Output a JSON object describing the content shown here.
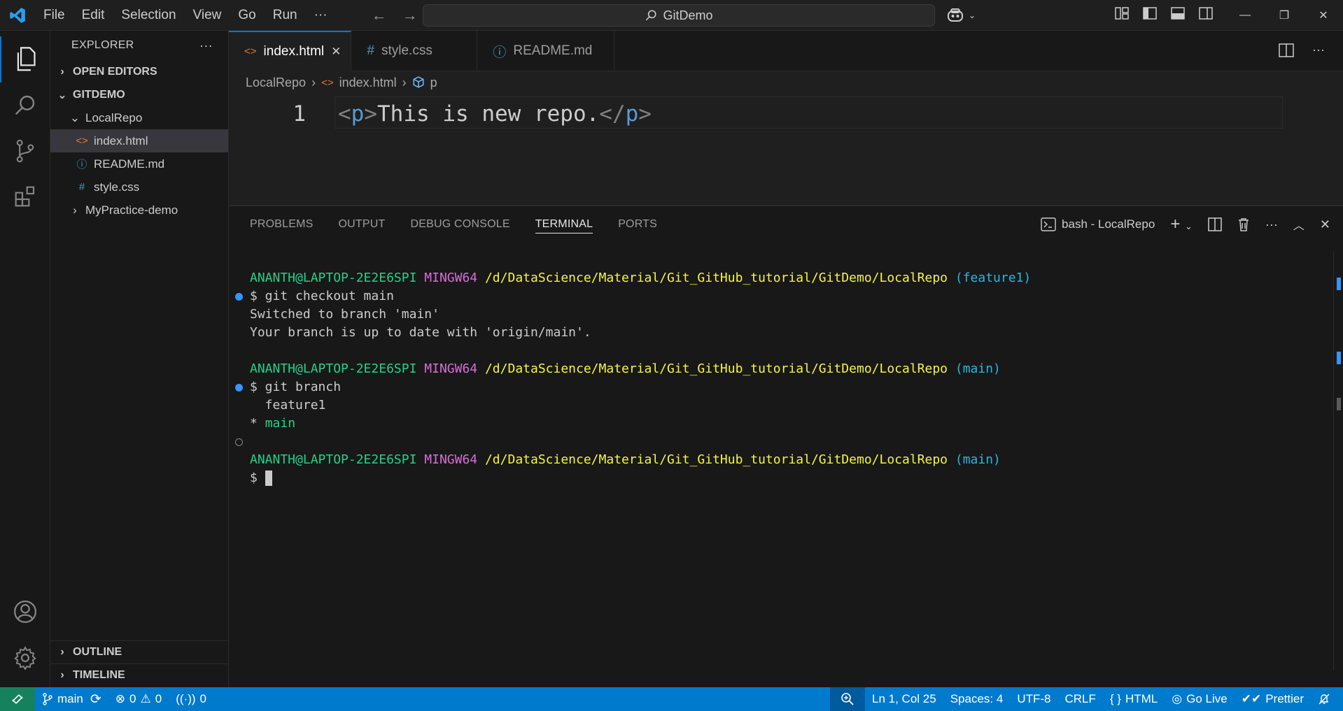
{
  "titlebar": {
    "menu": [
      "File",
      "Edit",
      "Selection",
      "View",
      "Go",
      "Run",
      "···"
    ],
    "search_text": "GitDemo"
  },
  "sidebar": {
    "title": "EXPLORER",
    "more": "···",
    "open_editors": "OPEN EDITORS",
    "workspace": "GITDEMO",
    "folder": "LocalRepo",
    "files": [
      "index.html",
      "README.md",
      "style.css"
    ],
    "other_folder": "MyPractice-demo",
    "outline": "OUTLINE",
    "timeline": "TIMELINE"
  },
  "tabs": [
    {
      "label": "index.html",
      "icon": "<>",
      "close": "✕"
    },
    {
      "label": "style.css",
      "icon": "#"
    },
    {
      "label": "README.md",
      "icon": "ⓘ"
    }
  ],
  "breadcrumb": {
    "folder": "LocalRepo",
    "file": "index.html",
    "symbol": "p"
  },
  "editor": {
    "line_number": "1",
    "open_lt": "<",
    "open_tag": "p",
    "open_gt": ">",
    "text": "This is new repo.",
    "close_lt": "</",
    "close_tag": "p",
    "close_gt": ">"
  },
  "panel": {
    "tabs": [
      "PROBLEMS",
      "OUTPUT",
      "DEBUG CONSOLE",
      "TERMINAL",
      "PORTS"
    ],
    "terminal_name": "bash - LocalRepo"
  },
  "terminal": {
    "user": "ANANTH@LAPTOP-2E2E6SPI",
    "host": "MINGW64",
    "path": "/d/DataScience/Material/Git_GitHub_tutorial/GitDemo/LocalRepo",
    "branch1": "(feature1)",
    "cmd1": "$ git checkout main",
    "out1": "Switched to branch 'main'",
    "out2": "Your branch is up to date with 'origin/main'.",
    "branch2": "(main)",
    "cmd2": "$ git branch",
    "out3": "  feature1",
    "out4_star": "* ",
    "out4": "main",
    "prompt": "$ "
  },
  "statusbar": {
    "branch": "main",
    "errors": "0",
    "warnings": "0",
    "ports": "0",
    "position": "Ln 1, Col 25",
    "spaces": "Spaces: 4",
    "encoding": "UTF-8",
    "eol": "CRLF",
    "language": "HTML",
    "golive": "Go Live",
    "prettier": "Prettier"
  },
  "colors": {
    "accent": "#007acc",
    "remote": "#16825d"
  }
}
